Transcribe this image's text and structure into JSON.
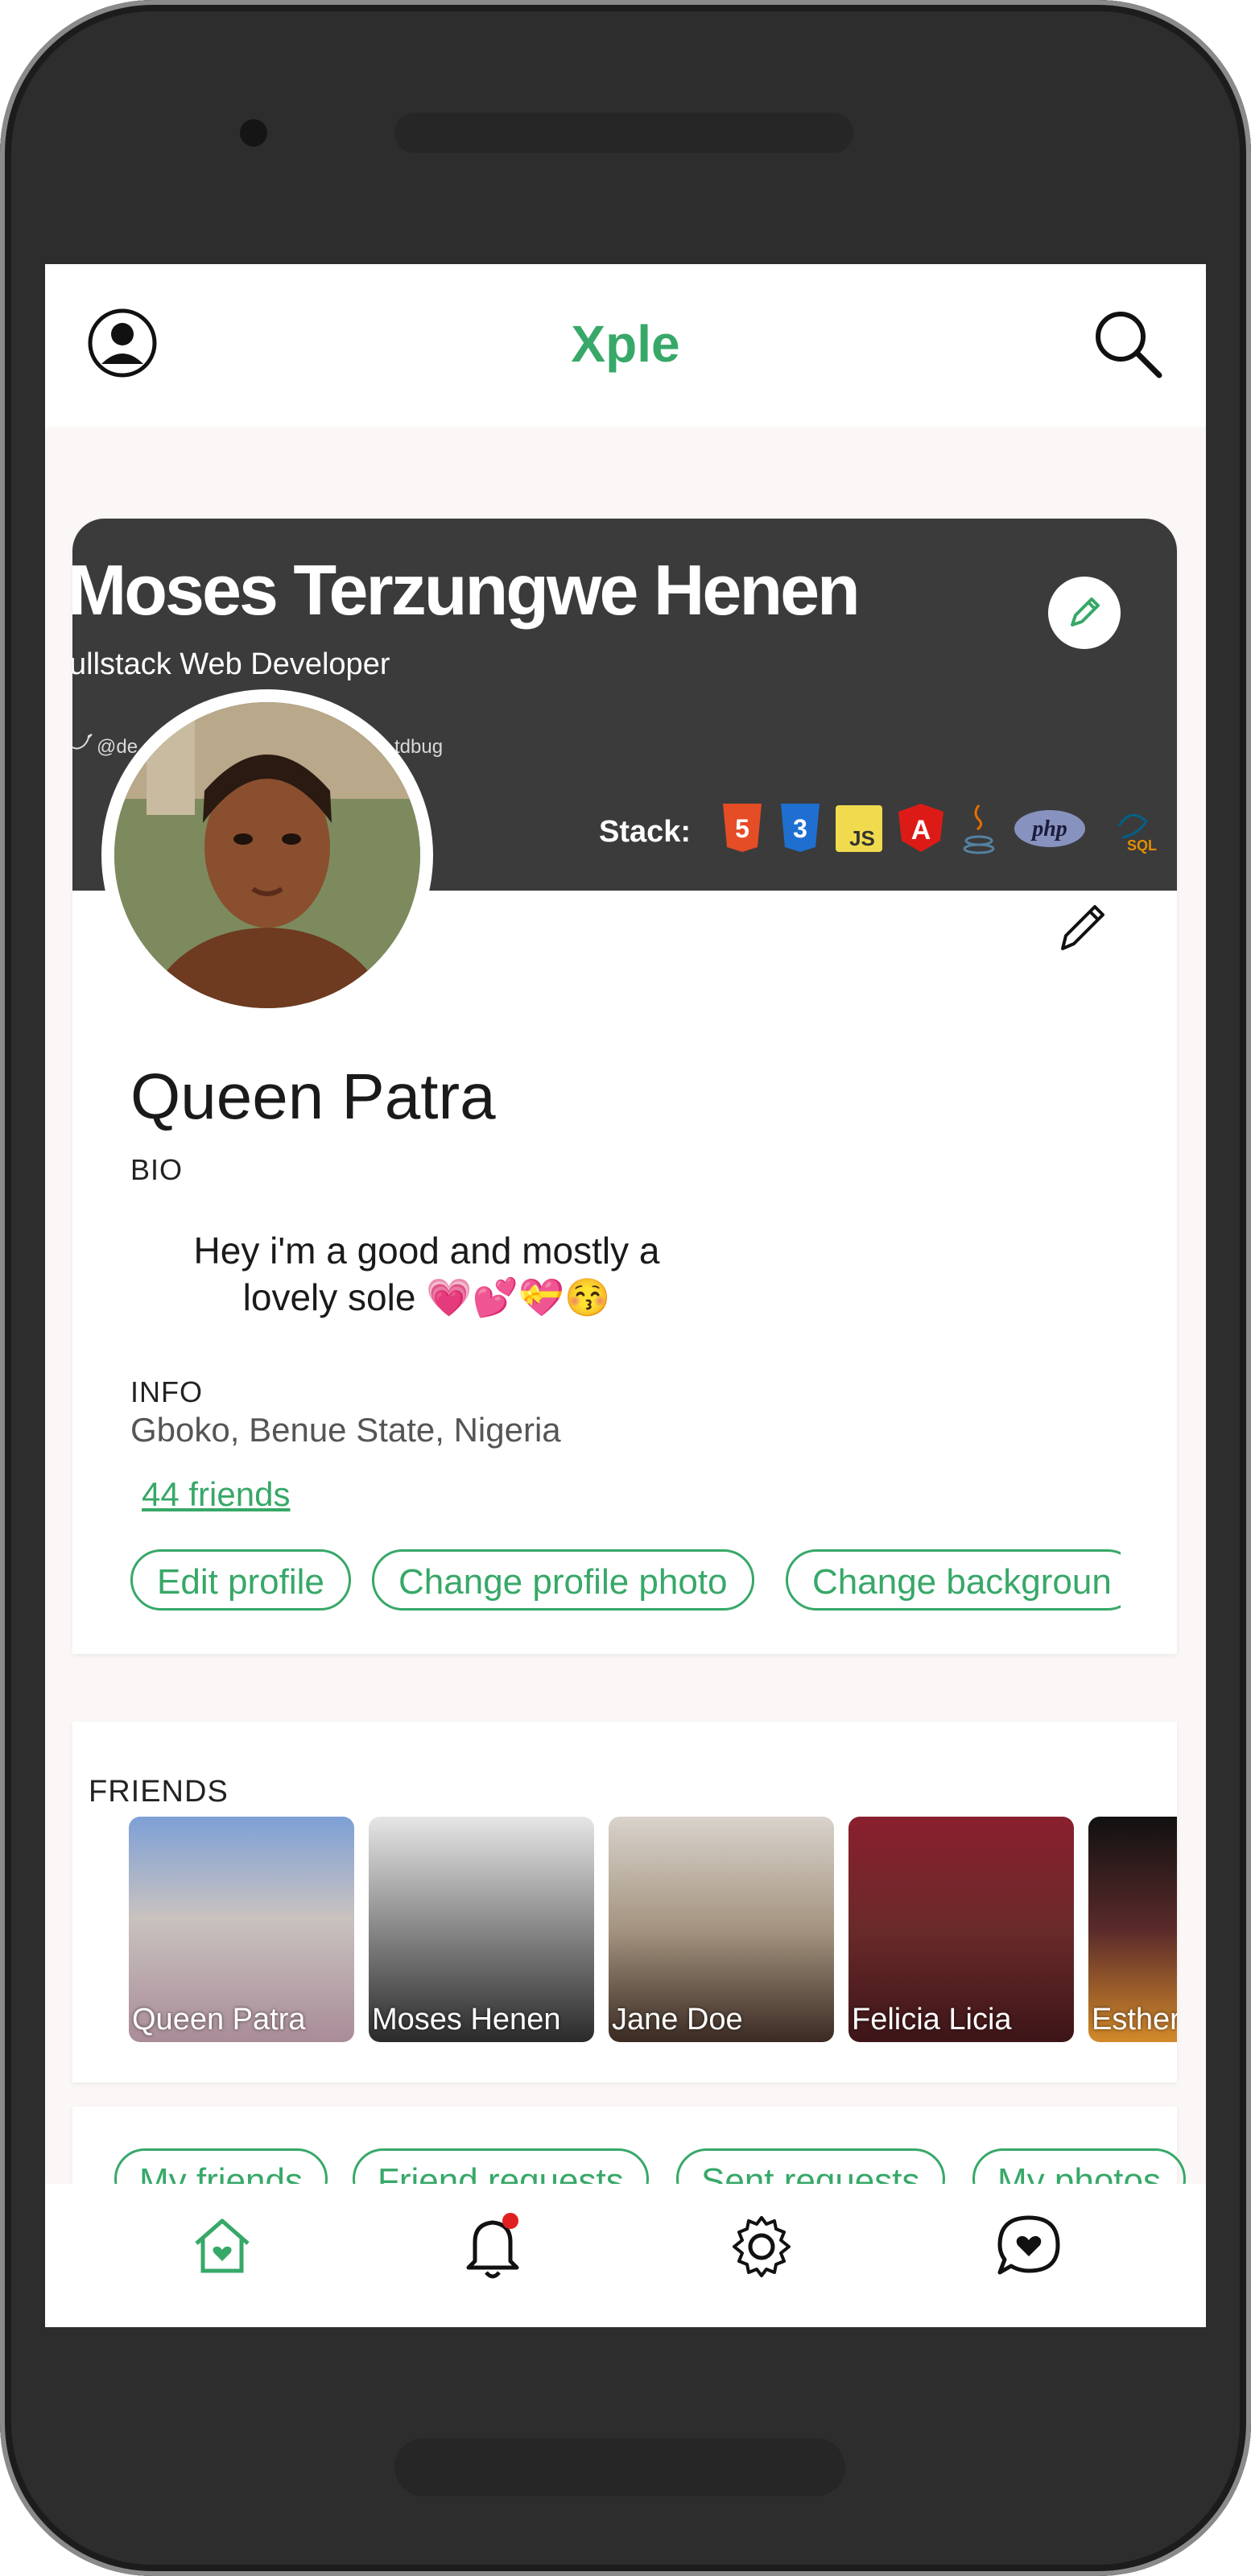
{
  "app": {
    "title": "Xple"
  },
  "colors": {
    "accent": "#37a868",
    "cover_bg": "#3b3b3b",
    "notification_dot": "#e02020"
  },
  "cover": {
    "name": "Moses Terzungwe Henen",
    "role": "ullstack Web Developer",
    "handle_left": "@de",
    "handle_right": "tdbug",
    "stack_label": "Stack:",
    "stack_icons": [
      "html5-icon",
      "css3-icon",
      "javascript-icon",
      "angular-icon",
      "java-icon",
      "php-icon",
      "sql-icon"
    ],
    "stack_icon_text": {
      "html5": "5",
      "css3": "3",
      "js": "JS",
      "angular": "A",
      "php": "php",
      "sql": "SQL"
    }
  },
  "profile": {
    "name": "Queen Patra",
    "bio_label": "BIO",
    "bio_line1": "Hey i'm a good and mostly a",
    "bio_line2": "lovely sole 💗💕💝😚",
    "info_label": "INFO",
    "location": "Gboko, Benue State, Nigeria",
    "friends_count": "44 friends",
    "actions": [
      "Edit profile",
      "Change profile photo",
      "Change backgroun"
    ]
  },
  "friends": {
    "title": "FRIENDS",
    "list": [
      "Queen Patra",
      "Moses Henen",
      "Jane Doe",
      "Felicia Licia",
      "Esther"
    ]
  },
  "tabs": [
    "My friends",
    "Friend requests",
    "Sent requests",
    "My photos"
  ],
  "bottom_nav": [
    "home-icon",
    "bell-icon",
    "settings-icon",
    "chat-heart-icon"
  ]
}
